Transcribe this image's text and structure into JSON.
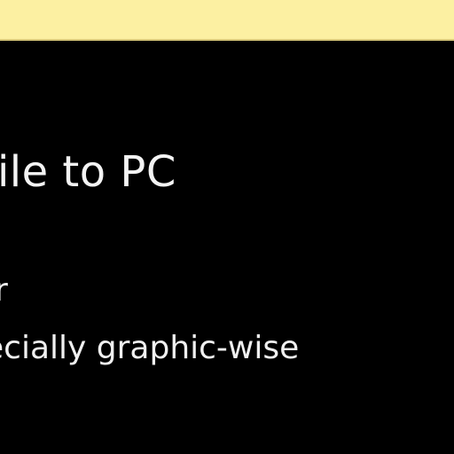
{
  "colors": {
    "top_strip": "#fcf0a2",
    "slide_background": "#000000",
    "text": "#f4f4f4"
  },
  "slide": {
    "title": "bile to PC",
    "bullets": [
      "r",
      "ecially graphic-wise"
    ]
  }
}
